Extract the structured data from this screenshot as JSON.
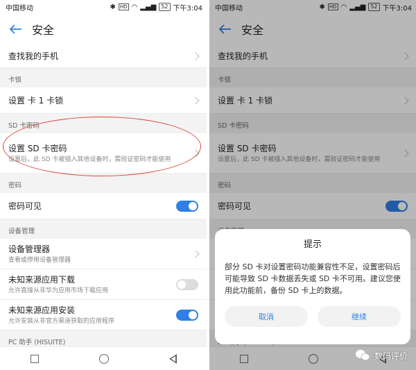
{
  "status": {
    "carrier": "中国移动",
    "battery": "52",
    "time": "下午3:04",
    "hd": "HD"
  },
  "header": {
    "title": "安全"
  },
  "list": {
    "find_phone": "查找我的手机",
    "sec_card_lock": "卡锁",
    "card_lock": "设置 卡 1 卡锁",
    "sec_sd": "SD 卡密码",
    "sd_title": "设置 SD 卡密码",
    "sd_sub": "设置后，此 SD 卡被插入其他设备时，需验证密码才能使用",
    "sec_pwd": "密码",
    "pwd_visible": "密码可见",
    "sec_dev": "设备管理",
    "dev_mgr": "设备管理器",
    "dev_mgr_sub": "查看或停用设备管理器",
    "unknown_dl": "未知来源应用下载",
    "unknown_dl_sub": "允许直接从非华为应用市场下载应用",
    "unknown_install": "未知来源应用安装",
    "unknown_install_sub": "允许安装从非官方渠道获取的应用程序",
    "pc_helper": "PC 助手 (HISUITE)"
  },
  "dialog": {
    "title": "提示",
    "message": "部分 SD 卡对设置密码功能兼容性不足，设置密码后可能导致 SD 卡数据丢失或 SD 卡不可用。建议您使用此功能前，备份 SD 卡上的数据。",
    "cancel": "取消",
    "continue": "继续"
  },
  "watermark": {
    "text": "数码评价"
  },
  "colors": {
    "accent": "#2f7fe6",
    "annotation": "#d9453a"
  },
  "toggles": {
    "pwd_visible": true,
    "unknown_dl": false,
    "unknown_install": true
  }
}
